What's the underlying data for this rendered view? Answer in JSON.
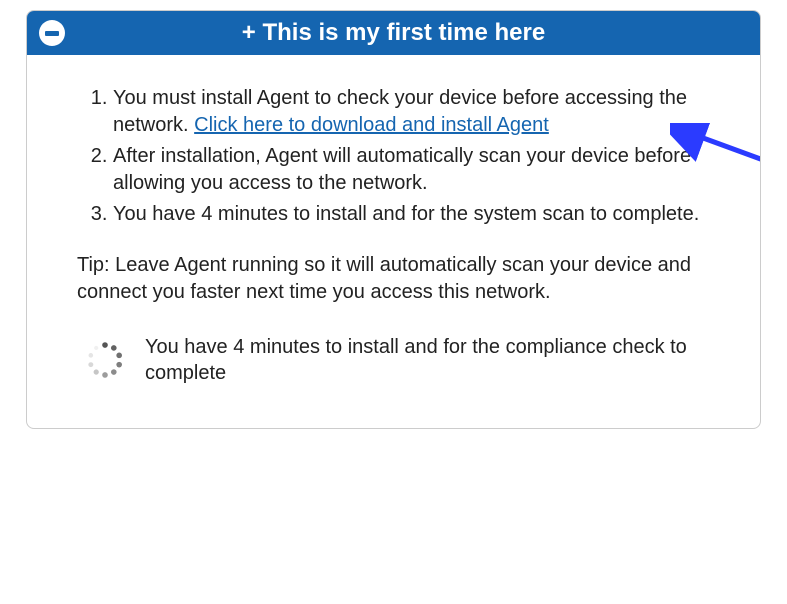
{
  "header": {
    "title": "+ This is my first time here"
  },
  "steps": {
    "item1_prefix": "You must install Agent to check your device before accessing the network. ",
    "item1_link": "Click here to download and install Agent",
    "item2": "After installation, Agent will automatically scan your device before allowing you access to the network.",
    "item3": "You have 4 minutes to install and for the system scan to complete."
  },
  "tip": "Tip: Leave Agent running so it will automatically scan your device and connect you faster next time you access this network.",
  "status": {
    "text": "You have 4 minutes to install and for the compliance check to complete"
  }
}
